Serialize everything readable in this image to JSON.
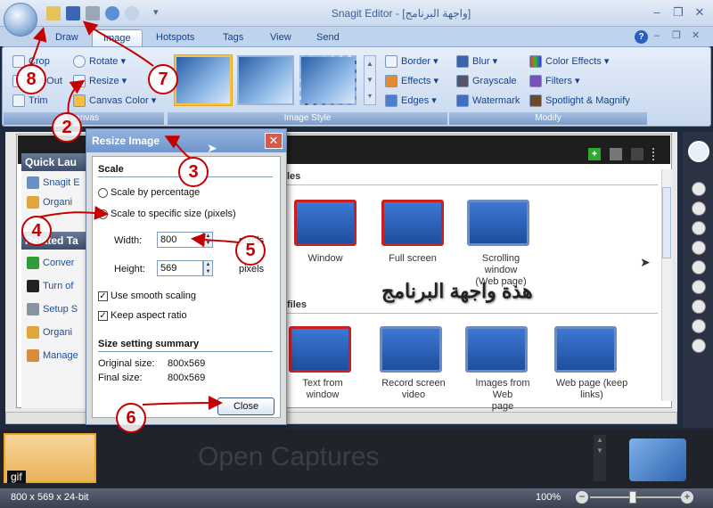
{
  "title": "Snagit Editor - [واجهة البرنامج]",
  "window_controls": {
    "minimize": "–",
    "restore": "❐",
    "close": "✕"
  },
  "ribbon_tabs": [
    "Draw",
    "Image",
    "Hotspots",
    "Tags",
    "View",
    "Send"
  ],
  "help_icon": "?",
  "canvas_group": {
    "label": "Canvas",
    "items": [
      "Crop",
      "Cut Out",
      "Trim",
      "Rotate",
      "Resize",
      "Canvas Color"
    ]
  },
  "image_style_group": {
    "label": "Image Style",
    "items": [
      "Border",
      "Effects",
      "Edges"
    ]
  },
  "modify_group": {
    "label": "Modify",
    "items": [
      "Blur",
      "Grayscale",
      "Watermark",
      "Color Effects",
      "Filters",
      "Spotlight & Magnify"
    ]
  },
  "left_panel": {
    "quick_launch": "Quick Lau",
    "quick_items": [
      "Snagit E",
      "Organi"
    ],
    "related": "Related Ta",
    "related_items": [
      "Conver",
      "Turn of",
      "Setup S",
      "Organi",
      "Manage"
    ]
  },
  "canvas_section_top": "les",
  "canvas_section_bottom": "files",
  "capture_tiles": {
    "row1": [
      "Window",
      "Full screen",
      "Scrolling window\n(Web page)"
    ],
    "row2": [
      "Text from window",
      "Record screen\nvideo",
      "Images from Web\npage",
      "Web page (keep\nlinks)"
    ]
  },
  "overlay_text": "هذة واجهة البرنامج",
  "dialog": {
    "title": "Resize Image",
    "scale_heading": "Scale",
    "opt_percentage": "Scale by percentage",
    "opt_specific": "Scale to specific size (pixels)",
    "width_label": "Width:",
    "width_value": "800",
    "height_label": "Height:",
    "height_value": "569",
    "unit": "pixels",
    "smooth": "Use smooth scaling",
    "aspect": "Keep aspect ratio",
    "summary_heading": "Size setting summary",
    "original_label": "Original size:",
    "original_value": "800x569",
    "final_label": "Final size:",
    "final_value": "800x569",
    "close_label": "Close"
  },
  "filmstrip": {
    "open_captures": "Open Captures",
    "thumb_label": "gif"
  },
  "status": {
    "info": "800 x 569 x 24-bit",
    "zoom": "100%"
  },
  "step_badges": [
    "2",
    "3",
    "4",
    "5",
    "6",
    "7",
    "8"
  ],
  "colors": {
    "accent": "#15428b",
    "badge": "#c40000",
    "tile_border": "#cc1f1f"
  }
}
